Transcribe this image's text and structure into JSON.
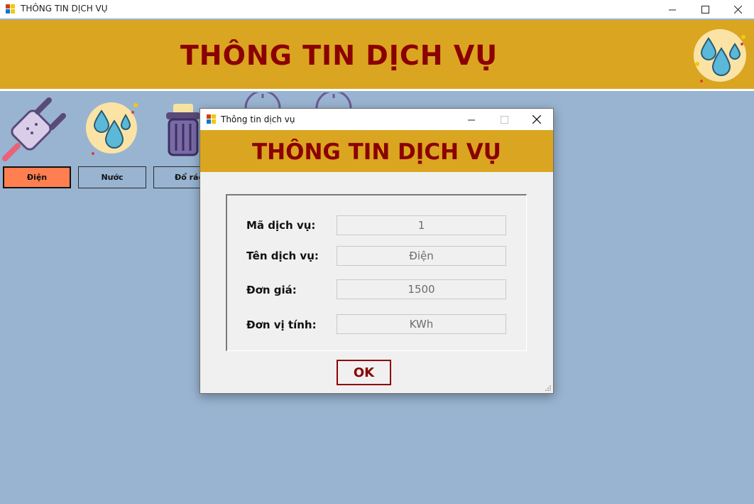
{
  "window": {
    "title": "THÔNG TIN DỊCH VỤ",
    "minimize": "—",
    "maximize": "☐",
    "close": "✕"
  },
  "banner": {
    "title": "THÔNG TIN DỊCH VỤ",
    "icon": "water-drops-icon"
  },
  "services": [
    {
      "label": "Điện",
      "icon": "plug-icon",
      "active": true
    },
    {
      "label": "Nước",
      "icon": "water-drops-icon",
      "active": false
    },
    {
      "label": "Đổ rác",
      "icon": "trash-bin-icon",
      "active": false
    }
  ],
  "dialog": {
    "title": "Thông tin dịch vụ",
    "banner_title": "THÔNG TIN DỊCH VỤ",
    "fields": [
      {
        "label": "Mã dịch vụ:",
        "value": "1"
      },
      {
        "label": "Tên dịch vụ:",
        "value": "Điện"
      },
      {
        "label": "Đơn giá:",
        "value": "1500"
      },
      {
        "label": "Đơn vị tính:",
        "value": "KWh"
      }
    ],
    "ok_label": "OK"
  },
  "colors": {
    "background": "#99b4d1",
    "banner": "#daa520",
    "title_text": "#8b0000",
    "active_button": "#ff7f50"
  }
}
